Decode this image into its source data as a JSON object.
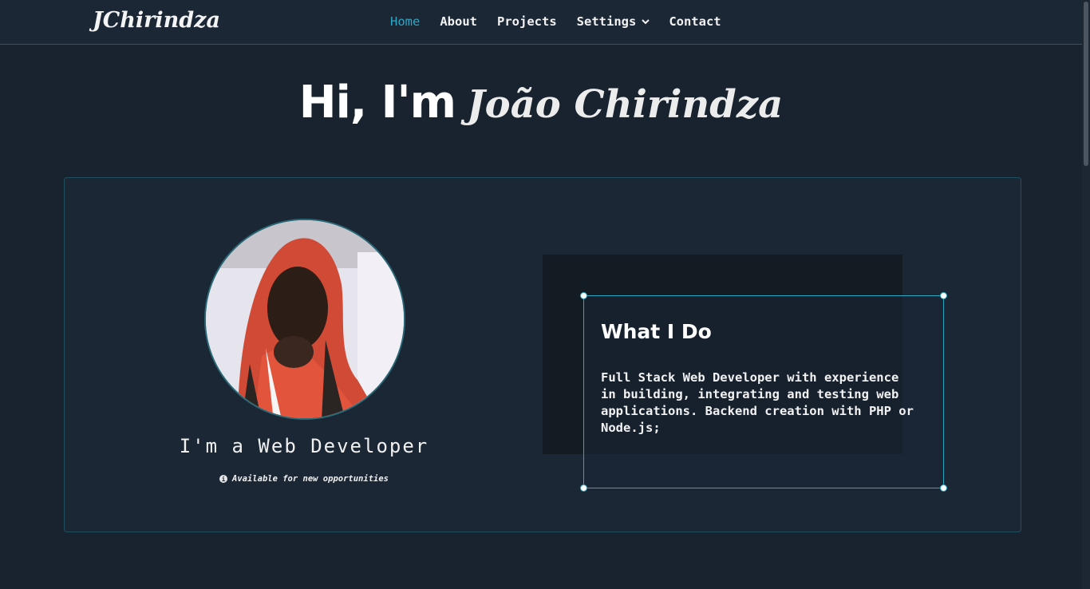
{
  "nav": {
    "logo": "JChirindza",
    "links": [
      "Home",
      "About",
      "Projects",
      "Settings",
      "Contact"
    ],
    "active": "Home",
    "accent": "#2ba8c6"
  },
  "hero": {
    "greeting": "Hi, I'm",
    "name": "João Chirindza"
  },
  "profile": {
    "role": "I'm a Web Developer",
    "availability": "Available for new opportunities",
    "availability_icon": "info-icon"
  },
  "what_i_do": {
    "title": "What I Do",
    "text": "Full Stack Web Developer with experience in building, integrating and testing web applications. Backend creation with PHP or Node.js;"
  },
  "colors": {
    "background": "#19232f",
    "card": "#1b2735",
    "border": "#2aa6c0"
  }
}
